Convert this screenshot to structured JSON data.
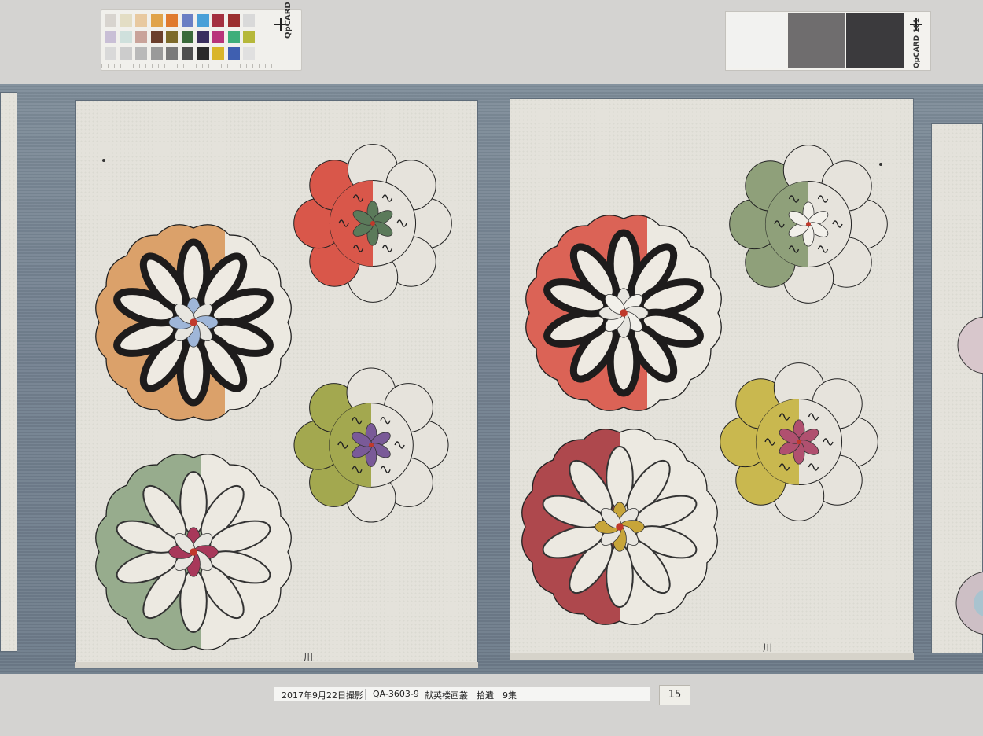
{
  "color_card": {
    "brand": "QpCARD",
    "swatches": [
      [
        "#d8d4cf",
        "#e3ddc4",
        "#e8c9a0",
        "#e0a34a",
        "#e07a2e",
        "#6b7fc4",
        "#4aa0d8",
        "#a43040",
        "#9b2f2f",
        "#d9d9d9"
      ],
      [
        "#c9bfd6",
        "#cfe0dc",
        "#c9a39a",
        "#6b3f2c",
        "#7d6a2a",
        "#3a6a3a",
        "#3a2f5f",
        "#b8337a",
        "#3fae7a",
        "#b6b83a"
      ],
      [
        "#d9d9d9",
        "#cccccc",
        "#b9b9b9",
        "#9a9a9a",
        "#7a7a7a",
        "#4f4f4f",
        "#2a2a2a",
        "#d9b52a",
        "#3f5fb0",
        "#e0e0e0"
      ]
    ]
  },
  "gray_card": {
    "brand": "QpCARD 101",
    "patches": [
      "#f2f2f0",
      "#6f6d6e",
      "#3b3a3d"
    ]
  },
  "label": {
    "date": "2017年9月22日撮影",
    "catalog": "QA-3603-9",
    "title": "献英楼画叢　拾遺　9集"
  },
  "page_number": "15",
  "sheet_marks": [
    "川",
    "川"
  ],
  "colors": {
    "mount": "#6f7d8b",
    "paper": "#e4e2db",
    "ink": "#1e1c1c"
  }
}
